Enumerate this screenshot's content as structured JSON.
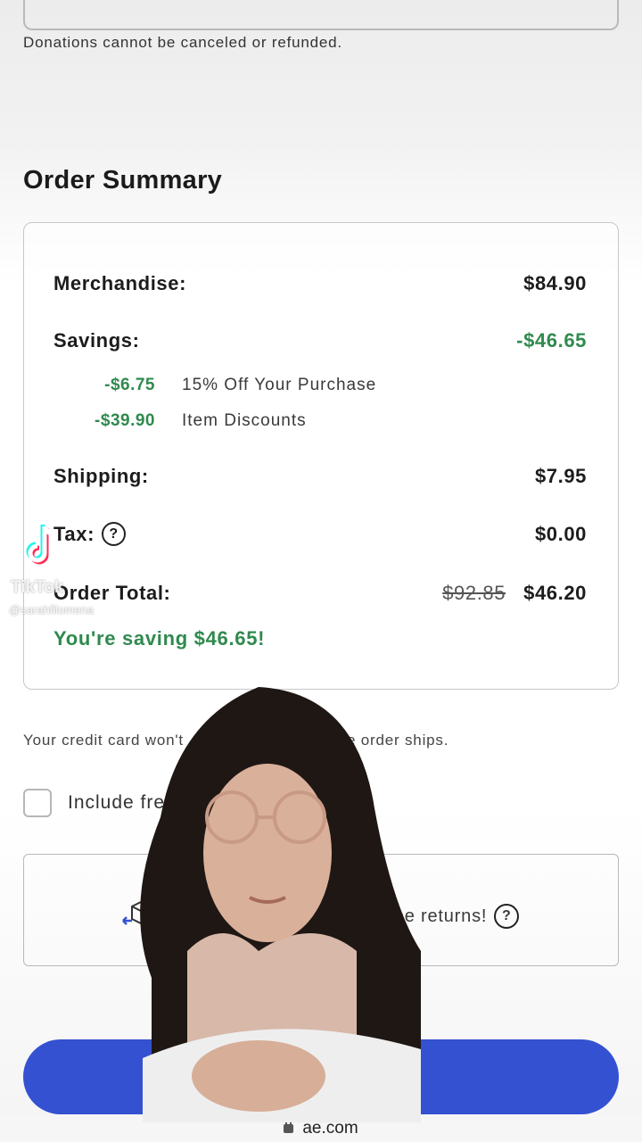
{
  "donation_note": "Donations cannot be canceled or refunded.",
  "order_summary": {
    "title": "Order Summary",
    "merchandise_label": "Merchandise:",
    "merchandise_value": "$84.90",
    "savings_label": "Savings:",
    "savings_value": "-$46.65",
    "savings_breakdown": [
      {
        "amount": "-$6.75",
        "description": "15% Off Your Purchase"
      },
      {
        "amount": "-$39.90",
        "description": "Item Discounts"
      }
    ],
    "shipping_label": "Shipping:",
    "shipping_value": "$7.95",
    "tax_label": "Tax:",
    "tax_help": "?",
    "tax_value": "$0.00",
    "total_label": "Order Total:",
    "total_original": "$92.85",
    "total_value": "$46.20",
    "saving_message": "You're saving $46.65!"
  },
  "credit_card_note": "Your credit card won't",
  "credit_card_note_end": "he entire order ships.",
  "include_free_label": "Include free",
  "returns_text": "free returns!",
  "returns_help": "?",
  "url": "ae.com",
  "watermark": {
    "brand": "TikTok",
    "user": "@sarahfilomena"
  },
  "colors": {
    "savings_green": "#2f8a4e",
    "checkout_blue": "#3451d1"
  }
}
